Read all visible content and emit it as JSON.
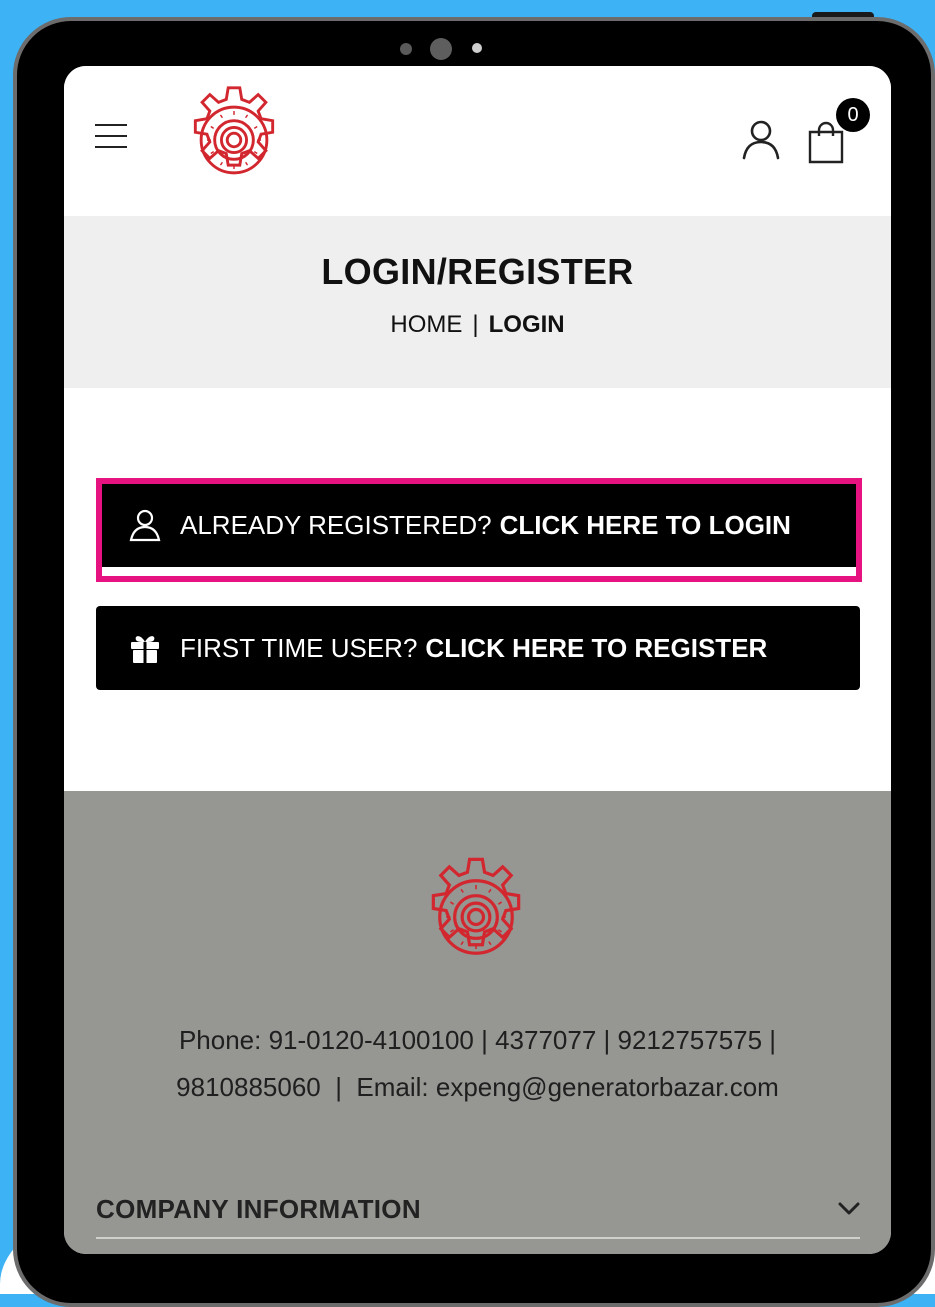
{
  "header": {
    "menu_icon": "hamburger-icon",
    "logo_icon": "gear-logo-icon",
    "account_icon": "user-icon",
    "cart_icon": "shopping-bag-icon",
    "cart_count": "0"
  },
  "page": {
    "title": "LOGIN/REGISTER",
    "breadcrumb": {
      "home": "HOME",
      "separator": "|",
      "current": "LOGIN"
    }
  },
  "actions": {
    "login": {
      "icon": "user-icon",
      "lead": "ALREADY REGISTERED?",
      "strong": "CLICK HERE TO LOGIN"
    },
    "register": {
      "icon": "gift-icon",
      "lead": "FIRST TIME USER?",
      "strong": "CLICK HERE TO REGISTER"
    }
  },
  "footer": {
    "logo_icon": "gear-logo-icon",
    "contact_line1": "Phone: 91-0120-4100100 | 4377077 | 9212757575 |",
    "contact_line2": "9810885060  |  Email: expeng@generatorbazar.com",
    "section_title": "COMPANY INFORMATION",
    "section_icon": "chevron-down-icon"
  },
  "colors": {
    "background": "#3db2f5",
    "highlight": "#e5127f",
    "logo": "#d2272f",
    "footer_bg": "#969693",
    "title_band": "#efefef"
  }
}
